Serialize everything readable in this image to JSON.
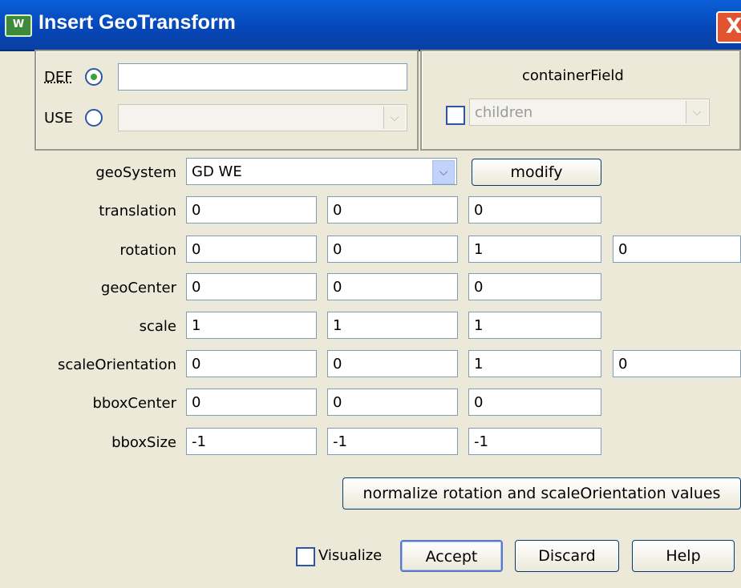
{
  "window": {
    "title": "Insert GeoTransform",
    "close_glyph": "X"
  },
  "def_use": {
    "def_label": "DEF",
    "use_label": "USE",
    "def_selected": true,
    "def_value": "",
    "use_value": ""
  },
  "container": {
    "title": "containerField",
    "value": "children",
    "checked": false
  },
  "fields": [
    {
      "label": "geoSystem"
    },
    {
      "label": "translation",
      "values": [
        "0",
        "0",
        "0"
      ]
    },
    {
      "label": "rotation",
      "values": [
        "0",
        "0",
        "1",
        "0"
      ]
    },
    {
      "label": "geoCenter",
      "values": [
        "0",
        "0",
        "0"
      ]
    },
    {
      "label": "scale",
      "values": [
        "1",
        "1",
        "1"
      ]
    },
    {
      "label": "scaleOrientation",
      "values": [
        "0",
        "0",
        "1",
        "0"
      ]
    },
    {
      "label": "bboxCenter",
      "values": [
        "0",
        "0",
        "0"
      ]
    },
    {
      "label": "bboxSize",
      "values": [
        "-1",
        "-1",
        "-1"
      ]
    }
  ],
  "geosystem": {
    "value": "GD WE",
    "modify_label": "modify"
  },
  "normalize_button": "normalize rotation and scaleOrientation values",
  "footer": {
    "visualize_label": "Visualize",
    "visualize_checked": false,
    "accept": "Accept",
    "discard": "Discard",
    "help": "Help"
  },
  "icons": [
    "window-app-icon",
    "close-icon",
    "chevron-down-icon"
  ]
}
